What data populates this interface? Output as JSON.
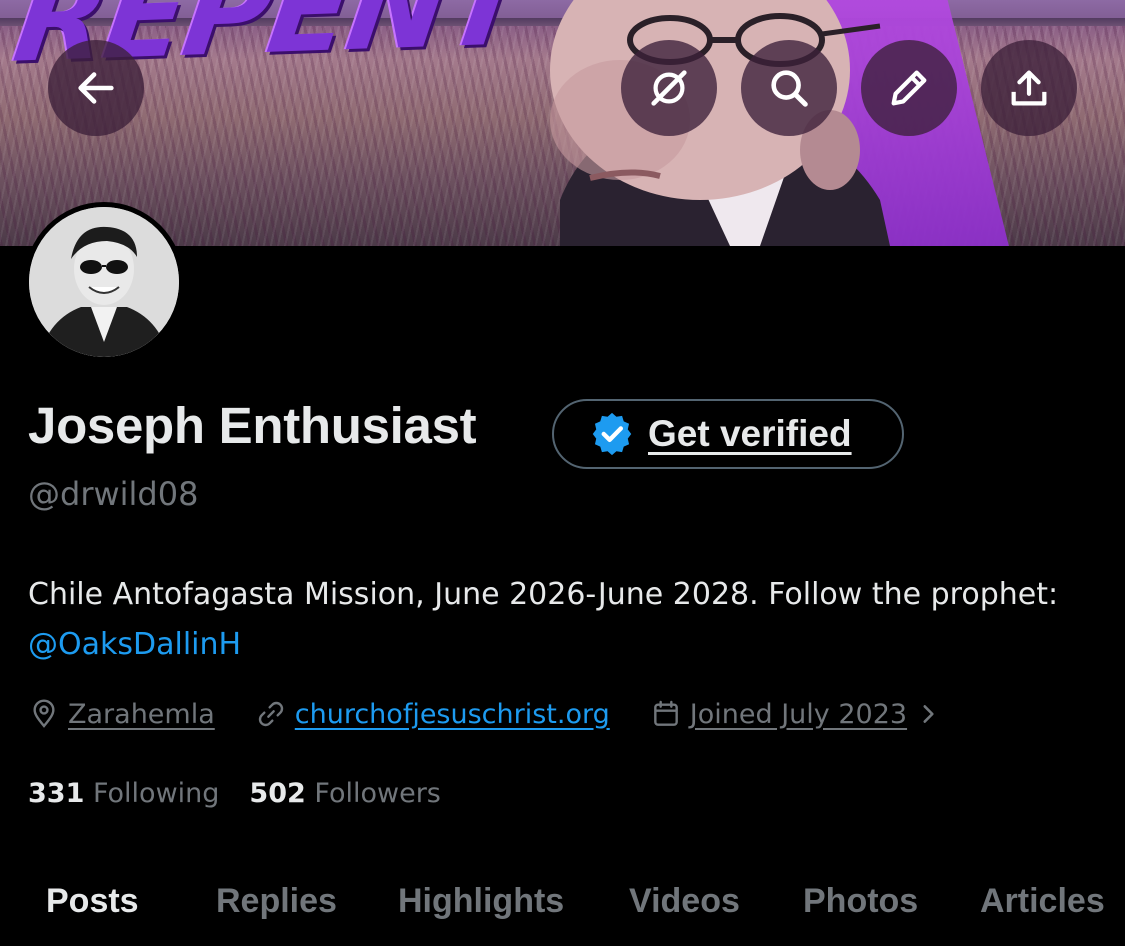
{
  "banner": {
    "overlay_text": "REPENT"
  },
  "toolbar": {
    "back_icon": "arrow-left-icon",
    "grok_icon": "grok-icon",
    "search_icon": "search-icon",
    "edit_icon": "pencil-icon",
    "share_icon": "share-upload-icon"
  },
  "profile": {
    "display_name": "Joseph Enthusiast",
    "handle": "@drwild08",
    "get_verified_label": "Get verified",
    "bio_text": "Chile Antofagasta Mission, June 2026-June 2028. Follow the prophet: ",
    "bio_mention": "@OaksDallinH",
    "location": "Zarahemla",
    "website": "churchofjesuschrist.org",
    "joined": "Joined July 2023"
  },
  "stats": {
    "following_count": "331",
    "following_label": "Following",
    "followers_count": "502",
    "followers_label": "Followers"
  },
  "tabs": [
    "Posts",
    "Replies",
    "Highlights",
    "Videos",
    "Photos",
    "Articles"
  ],
  "colors": {
    "background": "#000000",
    "text_primary": "#e7e9ea",
    "text_secondary": "#71767b",
    "accent_blue": "#1d9bf0",
    "banner_purple": "#7d34d6"
  }
}
